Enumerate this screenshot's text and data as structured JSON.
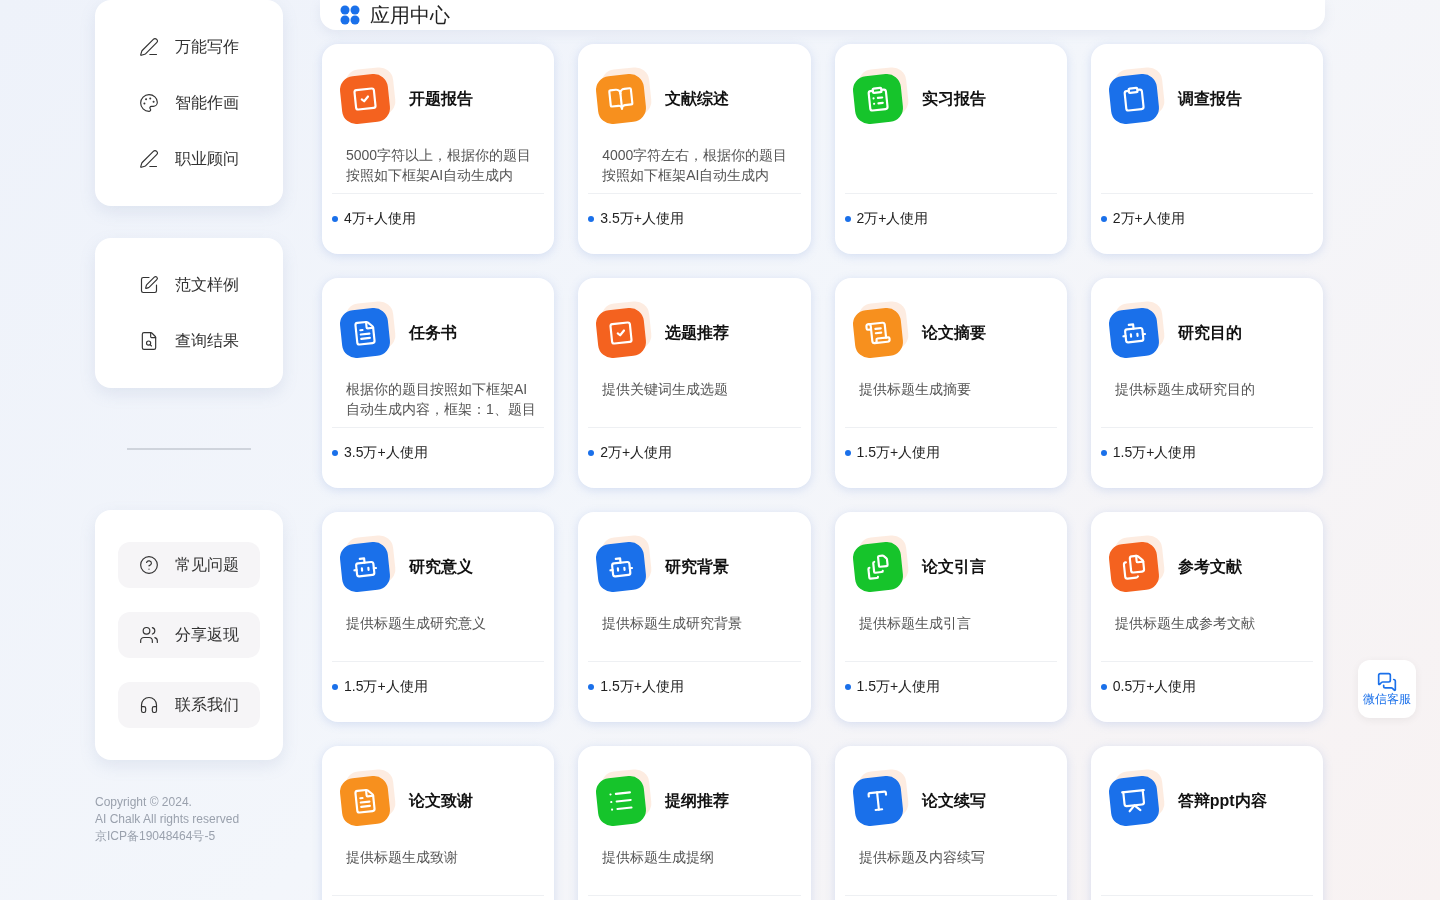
{
  "sidebar": {
    "groups": [
      {
        "kind": "plain",
        "items": [
          {
            "label": "万能写作"
          },
          {
            "label": "智能作画"
          },
          {
            "label": "职业顾问"
          }
        ]
      },
      {
        "kind": "plain",
        "items": [
          {
            "label": "范文样例"
          },
          {
            "label": "查询结果"
          }
        ]
      },
      {
        "kind": "pill",
        "items": [
          {
            "label": "常见问题"
          },
          {
            "label": "分享返现"
          },
          {
            "label": "联系我们"
          }
        ]
      }
    ],
    "footer": [
      "Copyright © 2024.",
      "AI Chalk All rights reserved",
      "京ICP备19048464号-5"
    ]
  },
  "header": {
    "title": "应用中心"
  },
  "apps": [
    {
      "title": "开题报告",
      "desc_lines": [
        "5000字符以上，根据你的题目",
        "按照如下框架AI自动生成内"
      ],
      "users": "4万+人使用",
      "color": "#f4621f"
    },
    {
      "title": "文献综述",
      "desc_lines": [
        "4000字符左右，根据你的题目",
        "按照如下框架AI自动生成内"
      ],
      "users": "3.5万+人使用",
      "color": "#f7901e"
    },
    {
      "title": "实习报告",
      "users": "2万+人使用",
      "color": "#16c42b"
    },
    {
      "title": "调查报告",
      "users": "2万+人使用",
      "color": "#1a70ea"
    },
    {
      "title": "任务书",
      "desc_lines": [
        "根据你的题目按照如下框架AI",
        "自动生成内容，框架：1、题目"
      ],
      "users": "3.5万+人使用",
      "color": "#1a70ea"
    },
    {
      "title": "选题推荐",
      "desc_lines": [
        "提供关键词生成选题"
      ],
      "users": "2万+人使用",
      "color": "#f4621f"
    },
    {
      "title": "论文摘要",
      "desc_lines": [
        "提供标题生成摘要"
      ],
      "users": "1.5万+人使用",
      "color": "#f7901e"
    },
    {
      "title": "研究目的",
      "desc_lines": [
        "提供标题生成研究目的"
      ],
      "users": "1.5万+人使用",
      "color": "#1a70ea"
    },
    {
      "title": "研究意义",
      "desc_lines": [
        "提供标题生成研究意义"
      ],
      "users": "1.5万+人使用",
      "color": "#1a70ea"
    },
    {
      "title": "研究背景",
      "desc_lines": [
        "提供标题生成研究背景"
      ],
      "users": "1.5万+人使用",
      "color": "#1a70ea"
    },
    {
      "title": "论文引言",
      "desc_lines": [
        "提供标题生成引言"
      ],
      "users": "1.5万+人使用",
      "color": "#16c42b"
    },
    {
      "title": "参考文献",
      "desc_lines": [
        "提供标题生成参考文献"
      ],
      "users": "0.5万+人使用",
      "color": "#f4621f"
    },
    {
      "title": "论文致谢",
      "desc_lines": [
        "提供标题生成致谢"
      ],
      "color": "#f7901e"
    },
    {
      "title": "提纲推荐",
      "desc_lines": [
        "提供标题生成提纲"
      ],
      "color": "#16c42b"
    },
    {
      "title": "论文续写",
      "desc_lines": [
        "提供标题及内容续写"
      ],
      "color": "#1a70ea"
    },
    {
      "title": "答辩ppt内容",
      "color": "#1a70ea"
    }
  ],
  "service_button": {
    "label": "微信客服"
  }
}
